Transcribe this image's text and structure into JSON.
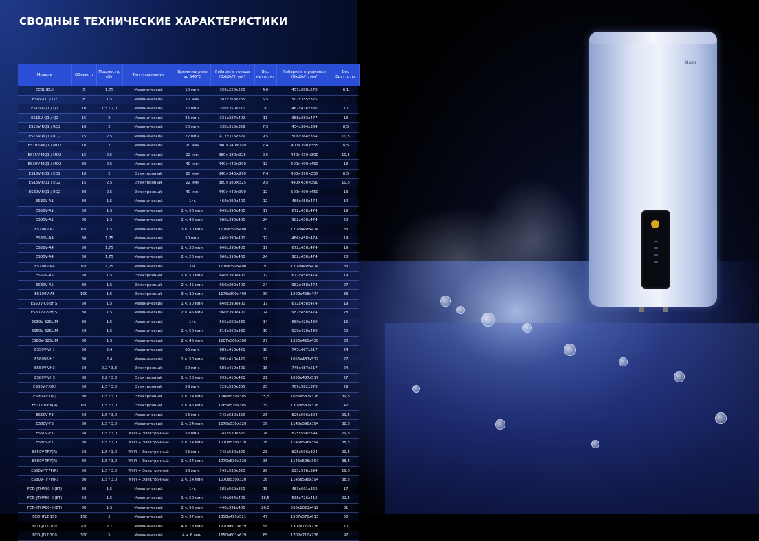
{
  "title": "СВОДНЫЕ ТЕХНИЧЕСКИЕ ХАРАКТЕРИСТИКИ",
  "brand": "Haier",
  "headers": [
    "Модель",
    "Объем, л",
    "Мощность, кВт",
    "Тип управления",
    "Время нагрева до Δ45°С",
    "Габариты товара (ВхШхГ), мм*",
    "Вес нетто, кг",
    "Габариты в упаковке (ВхШхГ), мм*",
    "Вес брутто, кг"
  ],
  "rows": [
    [
      "ECSU(EU)",
      "5",
      "1,75",
      "Механический",
      "10 мин.",
      "350x220x220",
      "4,6",
      "457x308x278",
      "6,1"
    ],
    [
      "ES8V-Q1 / Q2",
      "8",
      "1,5",
      "Механический",
      "17 мин",
      "387x263x255",
      "5,5",
      "502x355x325",
      "7"
    ],
    [
      "ES10V-Q1 / Q2",
      "10",
      "1,5 / 2,0",
      "Механический",
      "22 мин.",
      "350x350x270",
      "8",
      "462x416x336",
      "10"
    ],
    [
      "ES15V-Q1 / Q2",
      "15",
      "2",
      "Механический",
      "25 мин.",
      "331x327x402",
      "11",
      "388x383x477",
      "13"
    ],
    [
      "ES10V-RQ1 / RQ2",
      "10",
      "2",
      "Механический",
      "20 мин.",
      "330x315x329",
      "7,5",
      "434x364x364",
      "8,5"
    ],
    [
      "ES15V-RQ1 / RQ2",
      "15",
      "2,5",
      "Механический",
      "22 мин.",
      "412x315x329",
      "9,5",
      "506x364x364",
      "10,5"
    ],
    [
      "ES10V-MQ1 / MQ2",
      "10",
      "2",
      "Механический",
      "20 мин",
      "340×340×290",
      "7,4",
      "400×390×355",
      "8,5"
    ],
    [
      "ES15V-MQ1 / MQ2",
      "15",
      "2,5",
      "Механический",
      "22 мин",
      "380×380×325",
      "9,5",
      "440×430×390",
      "10,5"
    ],
    [
      "ES30V-MQ1 / MQ2",
      "30",
      "2,5",
      "Механический",
      "40 мин",
      "440×440×390",
      "12",
      "500×490×450",
      "13"
    ],
    [
      "ES10V-EQ1 / EQ2",
      "10",
      "2",
      "Электронный",
      "20 мин",
      "340×340×290",
      "7,4",
      "400×390×355",
      "8,5"
    ],
    [
      "ES15V-EQ1 / EQ2",
      "15",
      "2,5",
      "Электронный",
      "22 мин",
      "380×380×325",
      "9,5",
      "440×430×390",
      "10,5"
    ],
    [
      "ES30V-EQ1 / EQ2",
      "30",
      "2,5",
      "Электронный",
      "40 мин",
      "440×440×390",
      "12",
      "500×490×450",
      "13"
    ],
    [
      "ES30V-A1",
      "30",
      "1,5",
      "Механический",
      "1 ч.",
      "460x390x400",
      "12",
      "486x458x474",
      "14"
    ],
    [
      "ES50V-A1",
      "50",
      "1,5",
      "Механический",
      "1 ч. 50 мин.",
      "640x390x400",
      "17",
      "672x458x474",
      "19"
    ],
    [
      "ES80V-A1",
      "80",
      "1,5",
      "Механический",
      "2 ч. 45 мин.",
      "960x390x400",
      "24",
      "982x458x474",
      "28"
    ],
    [
      "ES100V-A1",
      "100",
      "1,5",
      "Механический",
      "3 ч. 30 мин.",
      "1176x390x400",
      "30",
      "1202x458x474",
      "33"
    ],
    [
      "ES30V-A4",
      "30",
      "1,75",
      "Механический",
      "50 мин.",
      "460x390x400",
      "12",
      "486x458x474",
      "14"
    ],
    [
      "ES50V-A4",
      "50",
      "1,75",
      "Механический",
      "1 ч. 30 мин.",
      "640x390x400",
      "17",
      "672x458x474",
      "19"
    ],
    [
      "ES80V-A4",
      "80",
      "1,75",
      "Механический",
      "2 ч. 20 мин.",
      "960x390x400",
      "24",
      "982x458x474",
      "28"
    ],
    [
      "ES100V-A4",
      "100",
      "1,75",
      "Механический",
      "3 ч.",
      "1176x390x400",
      "30",
      "1202x458x474",
      "33"
    ],
    [
      "ES50V-A5",
      "50",
      "1,5",
      "Электронный",
      "1 ч. 50 мин.",
      "640x390x400",
      "17",
      "672x458x474",
      "19"
    ],
    [
      "ES80V-A5",
      "80",
      "1,5",
      "Электронный",
      "2 ч. 45 мин.",
      "960x390x400",
      "24",
      "982x458x474",
      "27"
    ],
    [
      "ES100V-A5",
      "100",
      "1,5",
      "Электронный",
      "3 ч. 30 мин.",
      "1176x390x400",
      "30",
      "1202x458x474",
      "33"
    ],
    [
      "ES50V-Color(S)",
      "50",
      "1,5",
      "Механический",
      "1 ч. 50 мин.",
      "640x390x400",
      "17",
      "672x458x474",
      "19"
    ],
    [
      "ES80V-Color(S)",
      "80",
      "1,5",
      "Механический",
      "2 ч. 45 мин.",
      "960x390x400",
      "24",
      "982x458x474",
      "28"
    ],
    [
      "ES30V-B2SLIM",
      "30",
      "1,5",
      "Механический",
      "1 ч.",
      "565x360x380",
      "14",
      "680x420x430",
      "16"
    ],
    [
      "ES50V-B2SLIM",
      "50",
      "1,5",
      "Механический",
      "1 ч. 50 мин.",
      "818x360x380",
      "19",
      "920x420x430",
      "22"
    ],
    [
      "ES80V-B2SLIM",
      "80",
      "1,5",
      "Механический",
      "2 ч. 45 мин.",
      "1207x360x380",
      "27",
      "1350x420x430",
      "30"
    ],
    [
      "ES50V-VH1",
      "50",
      "2,4",
      "Механический",
      "66 мин.",
      "685x410x421",
      "18",
      "745x487x517",
      "24"
    ],
    [
      "ES80V-VH1",
      "80",
      "2,4",
      "Механический",
      "1 ч. 50 мин.",
      "995x410x421",
      "21",
      "1055x487x517",
      "27"
    ],
    [
      "ES50V-VH3",
      "50",
      "2,2 / 3,3",
      "Электронный",
      "50 мин.",
      "685x410x421",
      "18",
      "745x487x517",
      "24"
    ],
    [
      "ES80V-VH3",
      "80",
      "2,2 / 3,3",
      "Электронный",
      "1 ч. 20 мин.",
      "995x410x421",
      "21",
      "1055x487x517",
      "27"
    ],
    [
      "ES50V-FX(R)",
      "50",
      "1,5 / 3,0",
      "Электронный",
      "53 мин.",
      "720x530x305",
      "25",
      "769x582x378",
      "29"
    ],
    [
      "ES80V-FX(R)",
      "80",
      "1,5 / 3,0",
      "Электронный",
      "1 ч. 24 мин.",
      "1046x530x305",
      "35,5",
      "1086x582x378",
      "39,5"
    ],
    [
      "ES100V-FX(R)",
      "100",
      "1,5 / 3,0",
      "Электронный",
      "1 ч. 46 мин.",
      "1265x530x305",
      "39",
      "1302x582x378",
      "42"
    ],
    [
      "ES50V-F3",
      "50",
      "1,5 / 3,0",
      "Механический",
      "53 мин.",
      "745x530x320",
      "26",
      "825x596x394",
      "29,5"
    ],
    [
      "ES80V-F3",
      "80",
      "1,5 / 3,0",
      "Механический",
      "1 ч. 24 мин.",
      "1070x530x320",
      "36",
      "1145x596x394",
      "38,5"
    ],
    [
      "ES50V-F7",
      "50",
      "1,5 / 3,0",
      "Wi-Fi + Электронный",
      "53 мин.",
      "745x530x320",
      "26",
      "825x596x394",
      "29,5"
    ],
    [
      "ES80V-F7",
      "80",
      "1,5 / 3,0",
      "Wi-Fi + Электронный",
      "1 ч. 24 мин.",
      "1070x530x320",
      "36",
      "1145x596x394",
      "38,5"
    ],
    [
      "ES50V-TF7(R)",
      "50",
      "1,5 / 3,0",
      "Wi-Fi + Электронный",
      "53 мин.",
      "745x530x320",
      "26",
      "825x596x394",
      "29,5"
    ],
    [
      "ES80V-TF7(R)",
      "80",
      "1,5 / 3,0",
      "Wi-Fi + Электронный",
      "1 ч. 24 мин.",
      "1070x530x320",
      "36",
      "1145x596x394",
      "38,5"
    ],
    [
      "ES50V-TF7P(R)",
      "50",
      "1,5 / 3,0",
      "Wi-Fi + Электронный",
      "53 мин.",
      "745x530x320",
      "26",
      "825x596x394",
      "29,5"
    ],
    [
      "ES80V-TF7P(R)",
      "80",
      "1,5 / 3,0",
      "Wi-Fi + Электронный",
      "1 ч. 24 мин.",
      "1070x530x320",
      "36",
      "1145x596x394",
      "38,5"
    ],
    [
      "FCD-JTHA30-III(ET)",
      "30",
      "1,5",
      "Механический",
      "1 ч.",
      "385x569x350",
      "15",
      "483x601x362",
      "17"
    ],
    [
      "FCD-JTHA50-III(ET)",
      "50",
      "1,5",
      "Механический",
      "1 ч. 50 мин.",
      "440x694x400",
      "18,5",
      "538x726x412",
      "22,5"
    ],
    [
      "FCD-JTHA80-III(ET)",
      "80",
      "1,5",
      "Механический",
      "2 ч. 55 мин.",
      "440x991x400",
      "26,5",
      "538x1023x412",
      "31"
    ],
    [
      "FCD-JTLD150",
      "150",
      "2",
      "Механический",
      "3 ч. 57 мин.",
      "1358x499x521",
      "47",
      "1507x570x613",
      "56"
    ],
    [
      "FCD-JTLD200",
      "200",
      "2,7",
      "Механический",
      "4 ч. 13 мин.",
      "1220x601x629",
      "58",
      "1302x710x736",
      "70"
    ],
    [
      "FCD-JTLD300",
      "300",
      "5",
      "Механический",
      "4 ч. 6 мин.",
      "1650x601x629",
      "85",
      "1702x710x736",
      "97"
    ]
  ]
}
